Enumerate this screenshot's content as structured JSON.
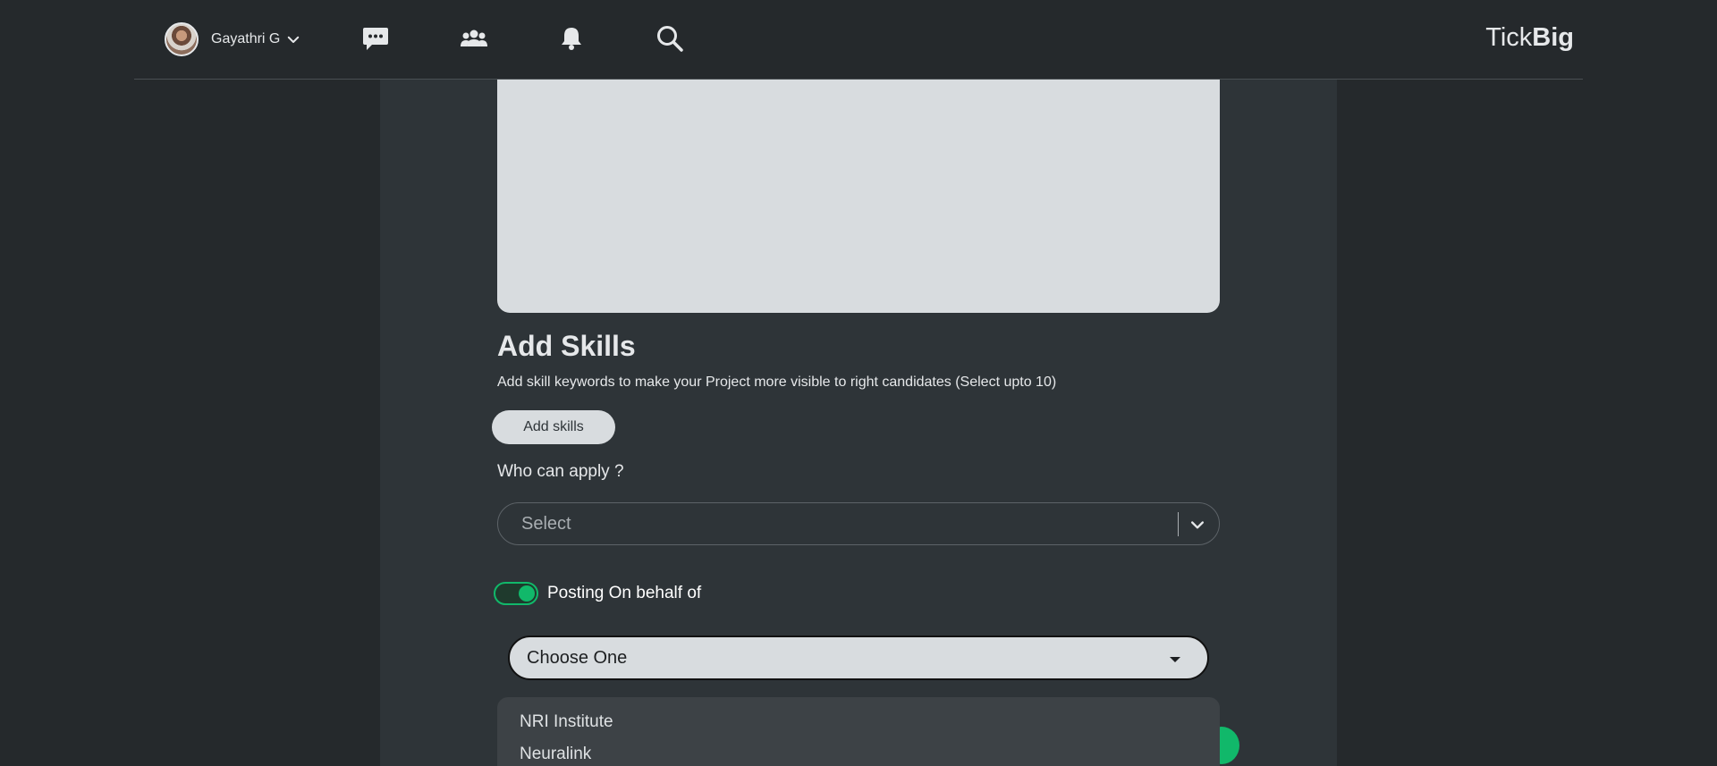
{
  "navbar": {
    "user_name": "Gayathri G",
    "brand_light": "Tick",
    "brand_bold": "Big",
    "icons": [
      "chat-icon",
      "groups-icon",
      "bell-icon",
      "search-icon"
    ]
  },
  "form": {
    "skills_title": "Add Skills",
    "skills_description": "Add skill keywords to make your Project more visible to right candidates (Select upto 10)",
    "add_skills_label": "Add skills",
    "who_can_apply_label": "Who can apply ?",
    "who_can_apply_placeholder": "Select",
    "posting_on_behalf_label": "Posting On behalf of",
    "posting_on_behalf_enabled": true,
    "choose_one_label": "Choose One",
    "dropdown_options": [
      "NRI Institute",
      "Neuralink"
    ]
  },
  "colors": {
    "background": "#25292c",
    "panel": "#2e3438",
    "accent_green": "#11b86a",
    "light_surface": "#d8dcdf"
  }
}
